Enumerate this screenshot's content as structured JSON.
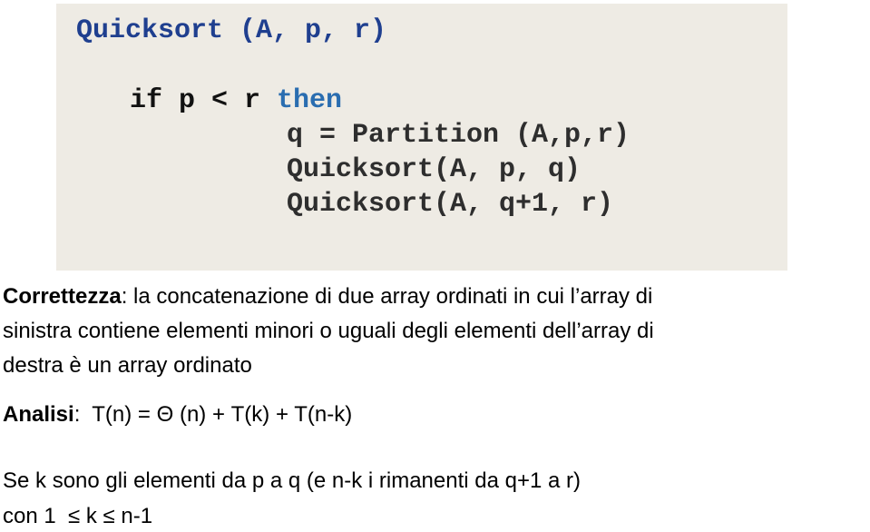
{
  "code": {
    "title": "Quicksort (A, p, r)",
    "if_keyword": "if p < r ",
    "then_keyword": "then",
    "line_partition": "q = Partition (A,p,r)",
    "line_rec1": "Quicksort(A, p, q)",
    "line_rec2": "Quicksort(A, q+1, r)",
    "colors": {
      "title": "#1f3f8f",
      "if": "#111111",
      "then": "#2a6db0",
      "body": "#2e2e2e",
      "background": "#eeebe4"
    }
  },
  "text": {
    "correctness_label": "Correttezza",
    "correctness_line1": ": la concatenazione di due array ordinati in cui l’array di",
    "correctness_line2": "sinistra contiene elementi minori o uguali degli elementi dell’array di",
    "correctness_line3": "destra è un array ordinato",
    "analysis_label": "Analisi",
    "analysis_formula": ":  T(n) = Θ (n) + T(k) + T(n-k)",
    "note_line1": "Se k sono gli elementi da p a q (e n-k i rimanenti da q+1 a r)",
    "note_line2": "con 1  ≤ k ≤ n-1"
  }
}
